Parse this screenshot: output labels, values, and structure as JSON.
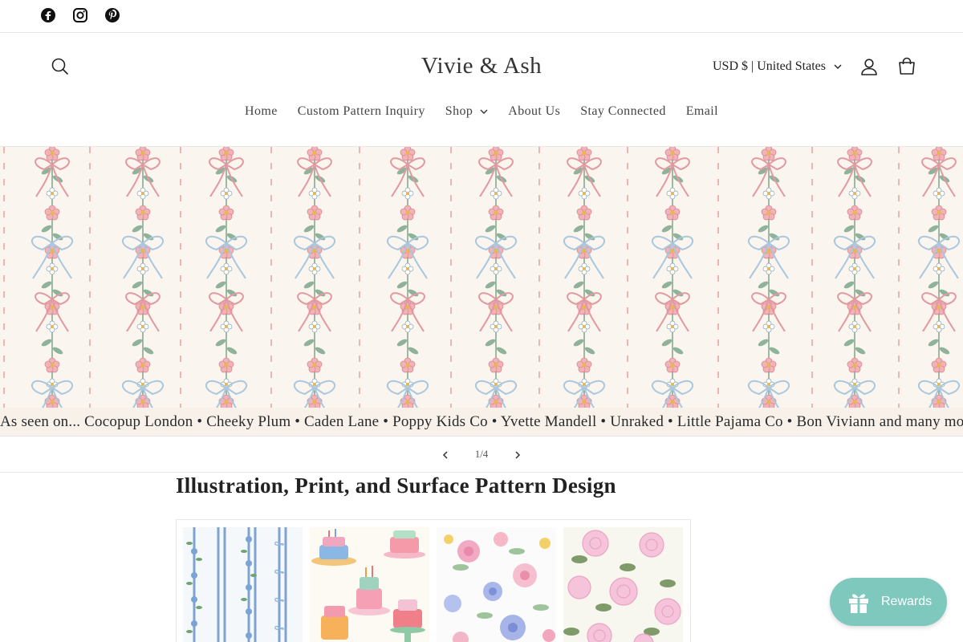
{
  "social": {
    "icons": [
      "facebook-icon",
      "instagram-icon",
      "pinterest-icon"
    ]
  },
  "header": {
    "brand": "Vivie & Ash",
    "currency": "USD $ | United States",
    "icons": [
      "search-icon",
      "account-icon",
      "cart-icon"
    ]
  },
  "nav": {
    "items": [
      {
        "label": "Home"
      },
      {
        "label": "Custom Pattern Inquiry"
      },
      {
        "label": "Shop"
      },
      {
        "label": "About Us"
      },
      {
        "label": "Stay Connected"
      },
      {
        "label": "Email"
      }
    ]
  },
  "banner": {
    "caption": "As seen on... Cocopup London • Cheeky Plum • Caden Lane • Poppy Kids Co • Yvette Mandell • Unraked • Little Pajama Co • Bon Viviann  and many more"
  },
  "slider": {
    "counter": "1/4"
  },
  "main": {
    "title": "Illustration, Print, and Surface Pattern Design"
  },
  "rewards": {
    "label": "Rewards"
  },
  "colors": {
    "accent": "#7fc8bd",
    "banner_bg": "#fbf5ef",
    "pink": "#e8a3a8",
    "leaf": "#7fa58a",
    "ribbon_blue": "#a9c7dd"
  }
}
